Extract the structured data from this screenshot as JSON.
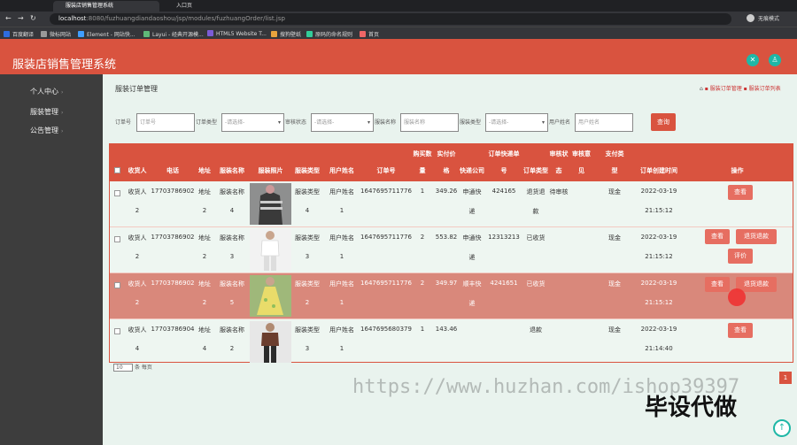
{
  "browser": {
    "tabs": [
      {
        "title": "服装店销售管理系统"
      },
      {
        "title": "入口页"
      }
    ],
    "url_host": "localhost",
    "url_rest": ":8080/fuzhuangdiandaoshou/jsp/modules/fuzhuangOrder/list.jsp",
    "profile_label": "无痕模式",
    "bookmarks": [
      "百度翻译",
      "微标网站",
      "Element - 网站快...",
      "Layui - 经典开源模...",
      "HTML5 Website T...",
      "搜狗壁纸",
      "原码的命名规则",
      "首页"
    ]
  },
  "app": {
    "title": "服装店销售管理系统"
  },
  "sidebar": {
    "items": [
      {
        "label": "个人中心"
      },
      {
        "label": "服装管理"
      },
      {
        "label": "公告管理"
      }
    ]
  },
  "page": {
    "title": "服装订单管理",
    "breadcrumb": [
      "服装订单管理",
      "服装订单列表"
    ]
  },
  "filters": {
    "order_no": {
      "label": "订单号",
      "placeholder": "订单号"
    },
    "order_type": {
      "label": "订单类型",
      "value": "-请选择-"
    },
    "audit_status": {
      "label": "审核状态",
      "value": "-请选择-"
    },
    "clothes_name": {
      "label": "服装名称",
      "placeholder": "服装名称"
    },
    "clothes_type": {
      "label": "服装类型",
      "value": "-请选择-"
    },
    "user_name": {
      "label": "用户姓名",
      "placeholder": "用户姓名"
    },
    "search_label": "查询"
  },
  "table": {
    "headers": {
      "receiver": "收货人",
      "phone": "电话",
      "address": "地址",
      "clothes_name": "服装名称",
      "clothes_photo": "服装照片",
      "clothes_type": "服装类型",
      "user_name": "用户姓名",
      "order_no": "订单号",
      "qty_top": "购买数",
      "qty_bot": "量",
      "paid_top": "实付价",
      "paid_bot": "格",
      "courier": "快递公司",
      "tracking_top": "订单快递单",
      "tracking_bot": "号",
      "order_type": "订单类型",
      "audit_top": "审核状",
      "audit_bot": "态",
      "opinion_top": "审核意",
      "opinion_bot": "见",
      "pay_top": "支付类",
      "pay_bot": "型",
      "created": "订单创建时间",
      "actions": "操作"
    },
    "rows": [
      {
        "receiver": [
          "收货人",
          "2"
        ],
        "phone": "17703786902",
        "address": [
          "地址",
          "2"
        ],
        "clothes_name": [
          "服装名称",
          "4"
        ],
        "clothes_type": [
          "服装类型",
          "4"
        ],
        "user_name": [
          "用户姓名",
          "1"
        ],
        "order_no": "1647695711776",
        "qty": "1",
        "paid": "349.26",
        "courier": [
          "申通快",
          "递"
        ],
        "tracking": "424165",
        "order_type": [
          "退货退",
          "款"
        ],
        "audit": "待审核",
        "pay": "现金",
        "created": [
          "2022-03-19",
          "21:15:12"
        ],
        "actions": [
          "查看"
        ]
      },
      {
        "receiver": [
          "收货人",
          "2"
        ],
        "phone": "17703786902",
        "address": [
          "地址",
          "2"
        ],
        "clothes_name": [
          "服装名称",
          "3"
        ],
        "clothes_type": [
          "服装类型",
          "3"
        ],
        "user_name": [
          "用户姓名",
          "1"
        ],
        "order_no": "1647695711776",
        "qty": "2",
        "paid": "553.82",
        "courier": [
          "申通快",
          "递"
        ],
        "tracking": "12313213",
        "order_type": [
          "已收货",
          ""
        ],
        "audit": "",
        "pay": "现金",
        "created": [
          "2022-03-19",
          "21:15:12"
        ],
        "actions": [
          "查看",
          "退货退款",
          "评价"
        ]
      },
      {
        "receiver": [
          "收货人",
          "2"
        ],
        "phone": "17703786902",
        "address": [
          "地址",
          "2"
        ],
        "clothes_name": [
          "服装名称",
          "5"
        ],
        "clothes_type": [
          "服装类型",
          "2"
        ],
        "user_name": [
          "用户姓名",
          "1"
        ],
        "order_no": "1647695711776",
        "qty": "2",
        "paid": "349.97",
        "courier": [
          "顺丰快",
          "递"
        ],
        "tracking": "4241651",
        "order_type": [
          "已收货",
          ""
        ],
        "audit": "",
        "pay": "现金",
        "created": [
          "2022-03-19",
          "21:15:12"
        ],
        "actions": [
          "查看",
          "退货退款"
        ]
      },
      {
        "receiver": [
          "收货人",
          "4"
        ],
        "phone": "17703786904",
        "address": [
          "地址",
          "4"
        ],
        "clothes_name": [
          "服装名称",
          "2"
        ],
        "clothes_type": [
          "服装类型",
          "3"
        ],
        "user_name": [
          "用户姓名",
          "1"
        ],
        "order_no": "1647695680379",
        "qty": "1",
        "paid": "143.46",
        "courier": [
          "",
          ""
        ],
        "tracking": "",
        "order_type": [
          "退款",
          ""
        ],
        "audit": "",
        "pay": "现金",
        "created": [
          "2022-03-19",
          "21:14:40"
        ],
        "actions": [
          "查看"
        ]
      }
    ]
  },
  "pager": {
    "page_size": "10",
    "suffix": "条 每页",
    "current_page": "1"
  },
  "overlays": {
    "watermark_url": "https://www.huzhan.com/ishop39397",
    "watermark_text": "毕设代做"
  },
  "colors": {
    "accent": "#d9533f",
    "teal": "#1fb7a6",
    "highlight_row": "#d9887b",
    "button": "#e66e61"
  }
}
